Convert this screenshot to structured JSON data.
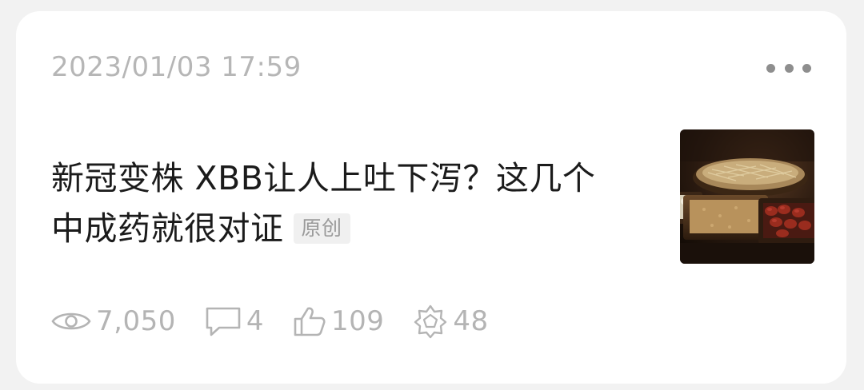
{
  "post": {
    "timestamp": "2023/01/03 17:59",
    "title": "新冠变株 XBB让人上吐下泻？这几个中成药就很对证",
    "badge": "原创",
    "thumbnail_icon": "herbal-medicine-photo"
  },
  "stats": {
    "views": "7,050",
    "comments": "4",
    "likes": "109",
    "shares": "48"
  },
  "colors": {
    "muted_text": "#b6b6b6",
    "title_text": "#1b1b1b",
    "card_bg": "#ffffff",
    "page_bg": "#f2f2f2"
  }
}
